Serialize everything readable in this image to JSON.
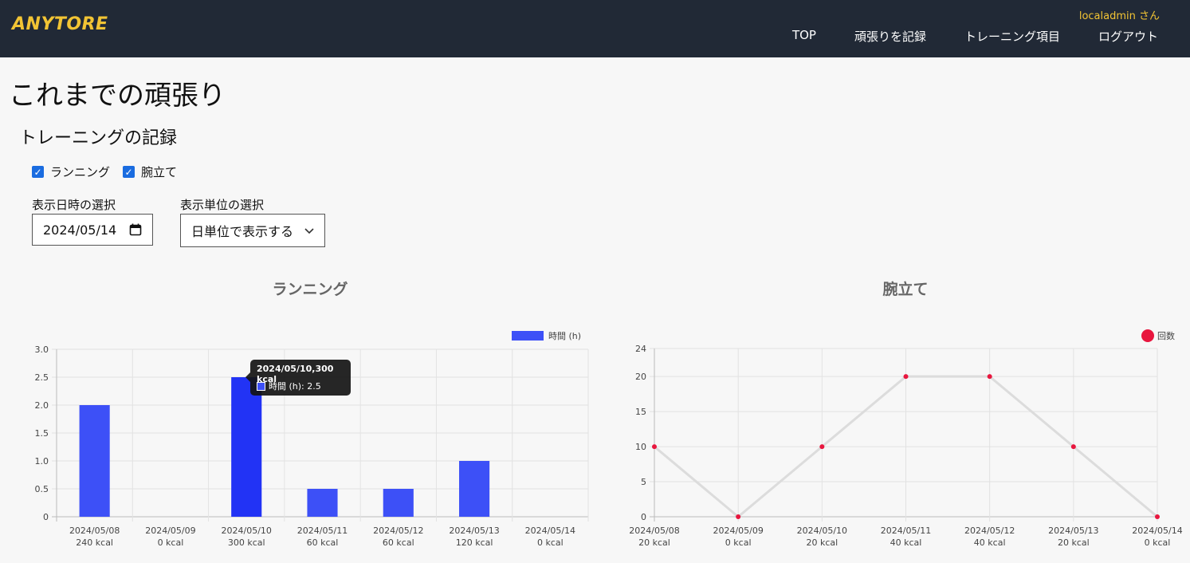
{
  "header": {
    "brand": "ANYTORE",
    "user": "localadmin さん",
    "nav": [
      "TOP",
      "頑張りを記録",
      "トレーニング項目",
      "ログアウト"
    ]
  },
  "page": {
    "title": "これまでの頑張り",
    "section_title": "トレーニングの記録"
  },
  "filters": {
    "checkboxes": [
      {
        "label": "ランニング",
        "checked": true
      },
      {
        "label": "腕立て",
        "checked": true
      }
    ],
    "date_label": "表示日時の選択",
    "date_value": "2024/05/14",
    "unit_label": "表示単位の選択",
    "unit_value": "日単位で表示する"
  },
  "colors": {
    "bar": "#3d50f7",
    "bar_active": "#2233f5",
    "line_point": "#e8163e",
    "line": "#dcdcdc"
  },
  "tooltip": {
    "title": "2024/05/10,300 kcal",
    "body": "時間 (h): 2.5"
  },
  "chart_data": [
    {
      "type": "bar",
      "title": "ランニング",
      "categories": [
        "2024/05/08",
        "2024/05/09",
        "2024/05/10",
        "2024/05/11",
        "2024/05/12",
        "2024/05/13",
        "2024/05/14"
      ],
      "sublabels": [
        "240 kcal",
        "0 kcal",
        "300 kcal",
        "60 kcal",
        "60 kcal",
        "120 kcal",
        "0 kcal"
      ],
      "series": [
        {
          "name": "時間 (h)",
          "values": [
            2,
            0,
            2.5,
            0.5,
            0.5,
            1,
            0
          ]
        }
      ],
      "yticks": [
        "0",
        "0.5",
        "1.0",
        "1.5",
        "2.0",
        "2.5",
        "3.0"
      ],
      "ylim": [
        0,
        3
      ],
      "grid": true,
      "legend": "top-right",
      "highlight_index": 2
    },
    {
      "type": "line",
      "title": "腕立て",
      "categories": [
        "2024/05/08",
        "2024/05/09",
        "2024/05/10",
        "2024/05/11",
        "2024/05/12",
        "2024/05/13",
        "2024/05/14"
      ],
      "sublabels": [
        "20 kcal",
        "0 kcal",
        "20 kcal",
        "40 kcal",
        "40 kcal",
        "20 kcal",
        "0 kcal"
      ],
      "series": [
        {
          "name": "回数",
          "values": [
            10,
            0,
            10,
            20,
            20,
            10,
            0
          ]
        }
      ],
      "yticks": [
        "0",
        "5",
        "10",
        "15",
        "20",
        "24"
      ],
      "ylim": [
        0,
        24
      ],
      "grid": true,
      "legend": "top-right"
    }
  ]
}
